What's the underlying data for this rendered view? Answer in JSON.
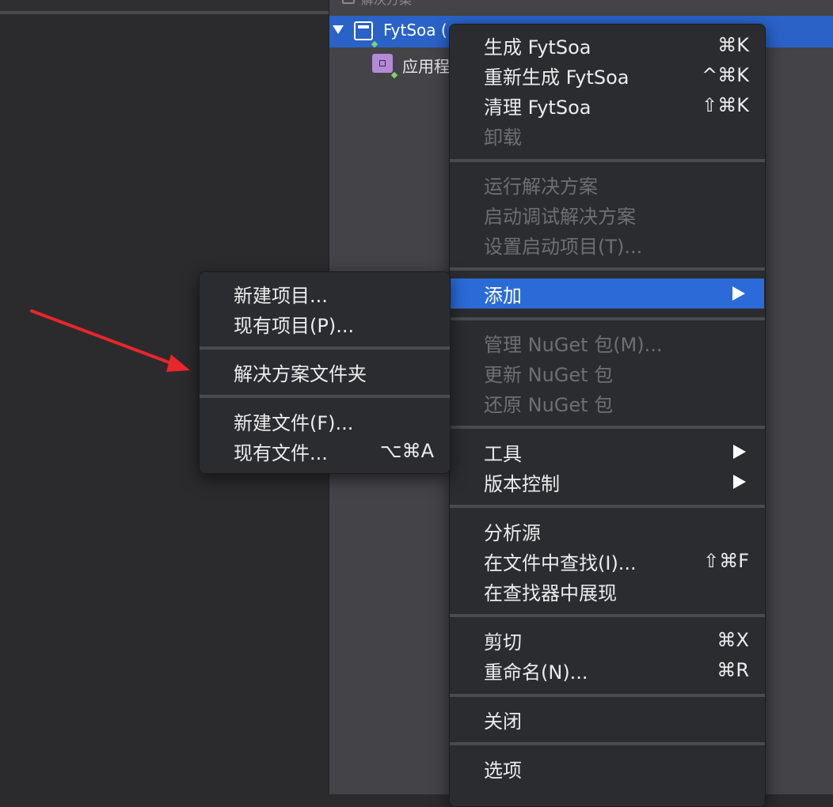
{
  "pane_header": {
    "title": "解决方案"
  },
  "tree": {
    "solution_label": "FytSoa (",
    "project_label": "应用程"
  },
  "main_menu": {
    "items": [
      {
        "label": "生成 FytSoa",
        "shortcut": "⌘K"
      },
      {
        "label": "重新生成 FytSoa",
        "shortcut": "^⌘K"
      },
      {
        "label": "清理 FytSoa",
        "shortcut": "⇧⌘K"
      },
      {
        "label": "卸载"
      },
      {
        "label": "运行解决方案"
      },
      {
        "label": "启动调试解决方案"
      },
      {
        "label": "设置启动项目(T)..."
      },
      {
        "label": "添加"
      },
      {
        "label": "管理 NuGet 包(M)..."
      },
      {
        "label": "更新 NuGet 包"
      },
      {
        "label": "还原 NuGet 包"
      },
      {
        "label": "工具"
      },
      {
        "label": "版本控制"
      },
      {
        "label": "分析源"
      },
      {
        "label": "在文件中查找(I)...",
        "shortcut": "⇧⌘F"
      },
      {
        "label": "在查找器中展现"
      },
      {
        "label": "剪切",
        "shortcut": "⌘X"
      },
      {
        "label": "重命名(N)...",
        "shortcut": "⌘R"
      },
      {
        "label": "关闭"
      },
      {
        "label": "选项"
      }
    ]
  },
  "sub_menu": {
    "items": [
      {
        "label": "新建项目..."
      },
      {
        "label": "现有项目(P)..."
      },
      {
        "label": "解决方案文件夹"
      },
      {
        "label": "新建文件(F)..."
      },
      {
        "label": "现有文件...",
        "shortcut": "⌥⌘A"
      }
    ]
  },
  "colors": {
    "selection": "#2a6bd8",
    "annotation_arrow": "#e8262b",
    "disabled_text": "#6e6f73"
  }
}
